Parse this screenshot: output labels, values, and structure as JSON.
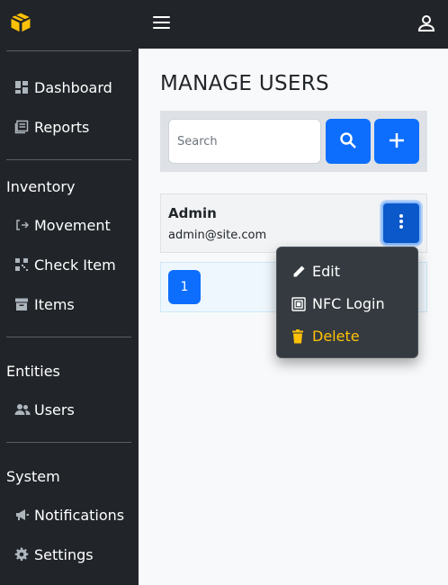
{
  "sidebar": {
    "items": [
      {
        "label": "Dashboard",
        "icon": "dashboard-icon"
      },
      {
        "label": "Reports",
        "icon": "reports-icon"
      },
      {
        "label": "Movement",
        "icon": "movement-icon"
      },
      {
        "label": "Check Item",
        "icon": "check-item-icon"
      },
      {
        "label": "Items",
        "icon": "items-box-icon"
      },
      {
        "label": "Users",
        "icon": "users-icon"
      },
      {
        "label": "Notifications",
        "icon": "megaphone-icon"
      },
      {
        "label": "Settings",
        "icon": "gear-icon"
      }
    ],
    "sections": {
      "inventory": "Inventory",
      "entities": "Entities",
      "system": "System"
    }
  },
  "page": {
    "title": "MANAGE USERS"
  },
  "search": {
    "placeholder": "Search"
  },
  "users": [
    {
      "name": "Admin",
      "email": "admin@site.com"
    }
  ],
  "pagination": {
    "current": "1"
  },
  "dropdown": {
    "edit": "Edit",
    "nfc_login": "NFC Login",
    "delete": "Delete"
  },
  "colors": {
    "sidebar_bg": "#212529",
    "primary": "#0d6efd",
    "delete_warning": "#ffc107",
    "logo": "#ffc107"
  }
}
